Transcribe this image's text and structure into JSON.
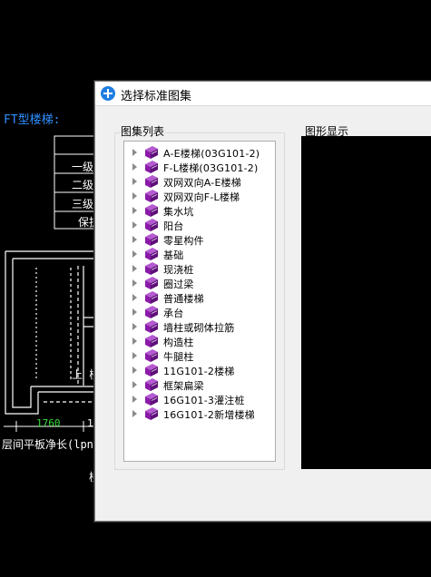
{
  "background_drawing": {
    "title": "FT型楼梯:",
    "table_rows": [
      "一级",
      "二级",
      "三级",
      "保护"
    ],
    "dimension": "1760",
    "dimension_partial": "1",
    "side_label": "上 楼",
    "bottom_label": "层间平板净长(lpn)",
    "bottom_char": "楼",
    "colors": {
      "title": "#2f8fff",
      "dimension": "#33dd33",
      "lines": "#ffffff"
    }
  },
  "dialog": {
    "title": "选择标准图集",
    "list_group_label": "图集列表",
    "preview_group_label": "图形显示",
    "items": [
      {
        "label": "A-E楼梯(03G101-2)"
      },
      {
        "label": "F-L楼梯(03G101-2)"
      },
      {
        "label": "双网双向A-E楼梯"
      },
      {
        "label": "双网双向F-L楼梯"
      },
      {
        "label": "集水坑"
      },
      {
        "label": "阳台"
      },
      {
        "label": "零星构件"
      },
      {
        "label": "基础"
      },
      {
        "label": "现浇桩"
      },
      {
        "label": "圈过梁"
      },
      {
        "label": "普通楼梯"
      },
      {
        "label": "承台"
      },
      {
        "label": "墙柱或砌体拉筋"
      },
      {
        "label": "构造柱"
      },
      {
        "label": "牛腿柱"
      },
      {
        "label": "11G101-2楼梯"
      },
      {
        "label": "框架扁梁"
      },
      {
        "label": "16G101-3灌注桩"
      },
      {
        "label": "16G101-2新增楼梯"
      }
    ],
    "icons": {
      "title": "app-icon",
      "item": "book-icon",
      "expander": "expand-arrow-icon"
    },
    "colors": {
      "book": "#8a1aa8"
    }
  }
}
